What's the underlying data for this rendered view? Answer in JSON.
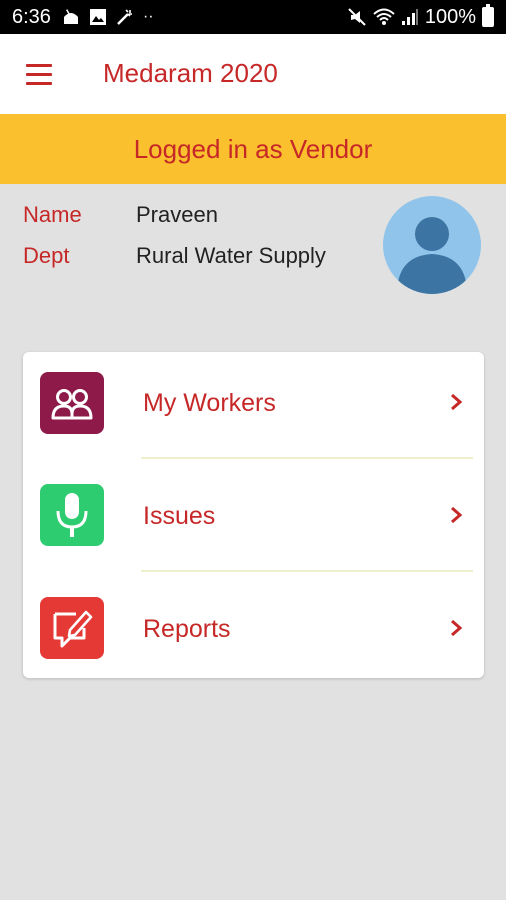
{
  "status_bar": {
    "time": "6:36",
    "battery": "100%",
    "left_icons": [
      "android-notification-icon",
      "image-notification-icon",
      "tools-notification-icon",
      "more-notifications-icon"
    ],
    "right_icons": [
      "mute-icon",
      "wifi-icon",
      "signal-icon",
      "battery-icon"
    ]
  },
  "app_bar": {
    "title": "Medaram 2020",
    "menu_icon": "hamburger-menu-icon"
  },
  "banner": {
    "text": "Logged in as Vendor"
  },
  "profile": {
    "name_label": "Name",
    "name_value": "Praveen",
    "dept_label": "Dept",
    "dept_value": "Rural Water Supply",
    "avatar_icon": "user-avatar-icon"
  },
  "menu": {
    "items": [
      {
        "label": "My Workers",
        "icon": "workers-icon",
        "icon_color": "#8e1a4a"
      },
      {
        "label": "Issues",
        "icon": "microphone-icon",
        "icon_color": "#2ecc71"
      },
      {
        "label": "Reports",
        "icon": "report-edit-icon",
        "icon_color": "#e53935"
      }
    ]
  },
  "colors": {
    "accent": "#c62828",
    "banner": "#fbc02d",
    "background": "#e1e1e1"
  }
}
